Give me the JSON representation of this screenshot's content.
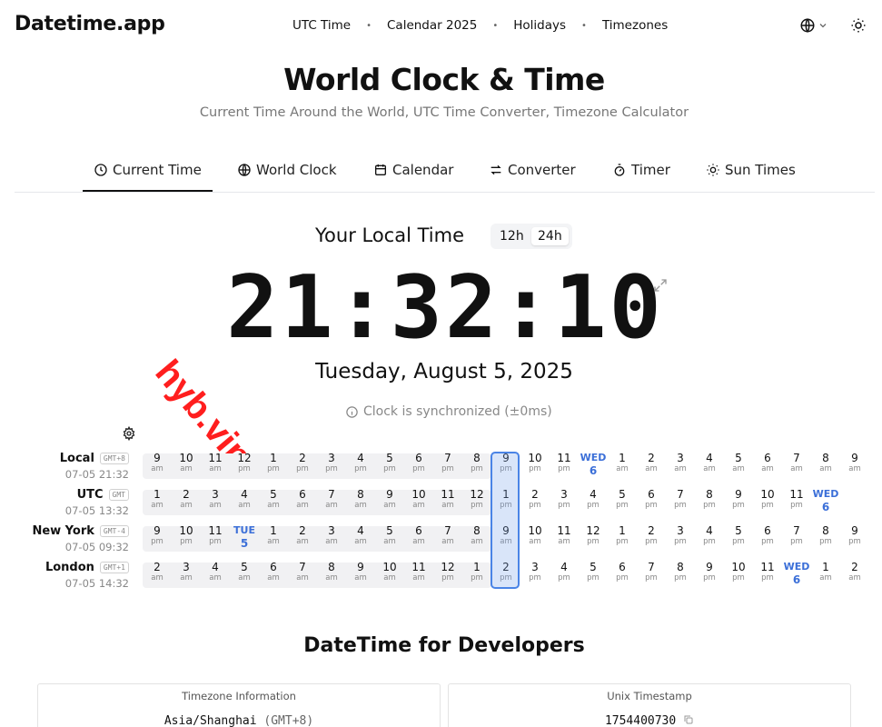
{
  "header": {
    "logo": "Datetime.app",
    "nav": [
      "UTC Time",
      "Calendar 2025",
      "Holidays",
      "Timezones"
    ],
    "nav_separator": "•"
  },
  "hero": {
    "title": "World Clock & Time",
    "subtitle": "Current Time Around the World, UTC Time Converter, Timezone Calculator"
  },
  "tabs": [
    {
      "label": "Current Time",
      "icon": "clock-icon",
      "active": true
    },
    {
      "label": "World Clock",
      "icon": "globe-icon",
      "active": false
    },
    {
      "label": "Calendar",
      "icon": "calendar-icon",
      "active": false
    },
    {
      "label": "Converter",
      "icon": "arrows-swap-icon",
      "active": false
    },
    {
      "label": "Timer",
      "icon": "stopwatch-icon",
      "active": false
    },
    {
      "label": "Sun Times",
      "icon": "sun-icon",
      "active": false
    }
  ],
  "local": {
    "title": "Your Local Time",
    "format_12h": "12h",
    "format_24h": "24h",
    "selected_format": "24h",
    "time": "21:32:10",
    "date": "Tuesday, August 5, 2025",
    "sync_status": "Clock is synchronized (±0ms)"
  },
  "watermark": "hyb.vip",
  "timezones": [
    {
      "name": "Local",
      "badge": "GMT+8",
      "datetime": "07-05 21:32",
      "hours": [
        {
          "n": "9",
          "p": "am"
        },
        {
          "n": "10",
          "p": "am"
        },
        {
          "n": "11",
          "p": "am"
        },
        {
          "n": "12",
          "p": "pm"
        },
        {
          "n": "1",
          "p": "pm"
        },
        {
          "n": "2",
          "p": "pm"
        },
        {
          "n": "3",
          "p": "pm"
        },
        {
          "n": "4",
          "p": "pm"
        },
        {
          "n": "5",
          "p": "pm"
        },
        {
          "n": "6",
          "p": "pm"
        },
        {
          "n": "7",
          "p": "pm"
        },
        {
          "n": "8",
          "p": "pm"
        },
        {
          "n": "9",
          "p": "pm"
        },
        {
          "n": "10",
          "p": "pm"
        },
        {
          "n": "11",
          "p": "pm"
        },
        {
          "n": "WED",
          "p": "6",
          "day": true
        },
        {
          "n": "1",
          "p": "am"
        },
        {
          "n": "2",
          "p": "am"
        },
        {
          "n": "3",
          "p": "am"
        },
        {
          "n": "4",
          "p": "am"
        },
        {
          "n": "5",
          "p": "am"
        },
        {
          "n": "6",
          "p": "am"
        },
        {
          "n": "7",
          "p": "am"
        },
        {
          "n": "8",
          "p": "am"
        },
        {
          "n": "9",
          "p": "am"
        }
      ]
    },
    {
      "name": "UTC",
      "badge": "GMT",
      "datetime": "07-05 13:32",
      "hours": [
        {
          "n": "1",
          "p": "am"
        },
        {
          "n": "2",
          "p": "am"
        },
        {
          "n": "3",
          "p": "am"
        },
        {
          "n": "4",
          "p": "am"
        },
        {
          "n": "5",
          "p": "am"
        },
        {
          "n": "6",
          "p": "am"
        },
        {
          "n": "7",
          "p": "am"
        },
        {
          "n": "8",
          "p": "am"
        },
        {
          "n": "9",
          "p": "am"
        },
        {
          "n": "10",
          "p": "am"
        },
        {
          "n": "11",
          "p": "am"
        },
        {
          "n": "12",
          "p": "pm"
        },
        {
          "n": "1",
          "p": "pm"
        },
        {
          "n": "2",
          "p": "pm"
        },
        {
          "n": "3",
          "p": "pm"
        },
        {
          "n": "4",
          "p": "pm"
        },
        {
          "n": "5",
          "p": "pm"
        },
        {
          "n": "6",
          "p": "pm"
        },
        {
          "n": "7",
          "p": "pm"
        },
        {
          "n": "8",
          "p": "pm"
        },
        {
          "n": "9",
          "p": "pm"
        },
        {
          "n": "10",
          "p": "pm"
        },
        {
          "n": "11",
          "p": "pm"
        },
        {
          "n": "WED",
          "p": "6",
          "day": true
        }
      ]
    },
    {
      "name": "New York",
      "badge": "GMT-4",
      "datetime": "07-05 09:32",
      "hours": [
        {
          "n": "9",
          "p": "pm"
        },
        {
          "n": "10",
          "p": "pm"
        },
        {
          "n": "11",
          "p": "pm"
        },
        {
          "n": "TUE",
          "p": "5",
          "day": true
        },
        {
          "n": "1",
          "p": "am"
        },
        {
          "n": "2",
          "p": "am"
        },
        {
          "n": "3",
          "p": "am"
        },
        {
          "n": "4",
          "p": "am"
        },
        {
          "n": "5",
          "p": "am"
        },
        {
          "n": "6",
          "p": "am"
        },
        {
          "n": "7",
          "p": "am"
        },
        {
          "n": "8",
          "p": "am"
        },
        {
          "n": "9",
          "p": "am"
        },
        {
          "n": "10",
          "p": "am"
        },
        {
          "n": "11",
          "p": "am"
        },
        {
          "n": "12",
          "p": "pm"
        },
        {
          "n": "1",
          "p": "pm"
        },
        {
          "n": "2",
          "p": "pm"
        },
        {
          "n": "3",
          "p": "pm"
        },
        {
          "n": "4",
          "p": "pm"
        },
        {
          "n": "5",
          "p": "pm"
        },
        {
          "n": "6",
          "p": "pm"
        },
        {
          "n": "7",
          "p": "pm"
        },
        {
          "n": "8",
          "p": "pm"
        },
        {
          "n": "9",
          "p": "pm"
        }
      ]
    },
    {
      "name": "London",
      "badge": "GMT+1",
      "datetime": "07-05 14:32",
      "hours": [
        {
          "n": "2",
          "p": "am"
        },
        {
          "n": "3",
          "p": "am"
        },
        {
          "n": "4",
          "p": "am"
        },
        {
          "n": "5",
          "p": "am"
        },
        {
          "n": "6",
          "p": "am"
        },
        {
          "n": "7",
          "p": "am"
        },
        {
          "n": "8",
          "p": "am"
        },
        {
          "n": "9",
          "p": "am"
        },
        {
          "n": "10",
          "p": "am"
        },
        {
          "n": "11",
          "p": "am"
        },
        {
          "n": "12",
          "p": "pm"
        },
        {
          "n": "1",
          "p": "pm"
        },
        {
          "n": "2",
          "p": "pm"
        },
        {
          "n": "3",
          "p": "pm"
        },
        {
          "n": "4",
          "p": "pm"
        },
        {
          "n": "5",
          "p": "pm"
        },
        {
          "n": "6",
          "p": "pm"
        },
        {
          "n": "7",
          "p": "pm"
        },
        {
          "n": "8",
          "p": "pm"
        },
        {
          "n": "9",
          "p": "pm"
        },
        {
          "n": "10",
          "p": "pm"
        },
        {
          "n": "11",
          "p": "pm"
        },
        {
          "n": "WED",
          "p": "6",
          "day": true
        },
        {
          "n": "1",
          "p": "am"
        },
        {
          "n": "2",
          "p": "am"
        }
      ]
    }
  ],
  "developers": {
    "title": "DateTime for Developers",
    "cards": [
      {
        "title": "Timezone Information",
        "value": "Asia/Shanghai",
        "suffix": "(GMT+8)"
      },
      {
        "title": "Unix Timestamp",
        "value": "1754400730"
      }
    ]
  },
  "colors": {
    "accent": "#3b6fd8",
    "highlight_border": "#4a84e6",
    "watermark": "#ff1e1e"
  }
}
